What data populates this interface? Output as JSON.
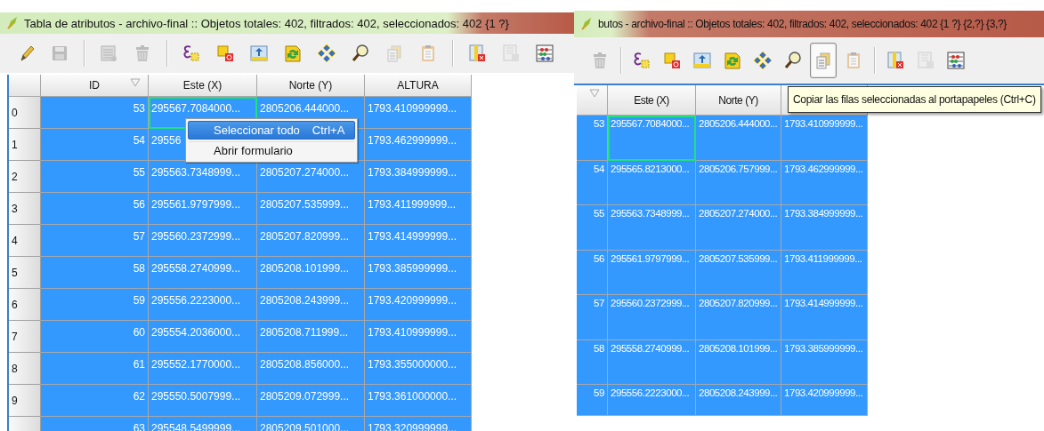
{
  "panels": [
    {
      "title": "Tabla de atributos - archivo-final :: Objetos totales: 402, filtrados: 402, seleccionados: 402 {1 ?}",
      "toolbar": [
        {
          "kind": "edit",
          "disabled": false,
          "hovered": false
        },
        {
          "kind": "save",
          "disabled": true,
          "hovered": false
        },
        {
          "kind": "separator"
        },
        {
          "kind": "delete-rows",
          "disabled": true,
          "hovered": false
        },
        {
          "kind": "trash",
          "disabled": true,
          "hovered": false
        },
        {
          "kind": "separator"
        },
        {
          "kind": "expression",
          "disabled": false,
          "hovered": false
        },
        {
          "kind": "deselect",
          "disabled": false,
          "hovered": false
        },
        {
          "kind": "move-top",
          "disabled": false,
          "hovered": false
        },
        {
          "kind": "invert",
          "disabled": false,
          "hovered": false
        },
        {
          "kind": "pan",
          "disabled": false,
          "hovered": false
        },
        {
          "kind": "zoom",
          "disabled": false,
          "hovered": false
        },
        {
          "kind": "copy",
          "disabled": true,
          "hovered": false
        },
        {
          "kind": "paste",
          "disabled": true,
          "hovered": false
        },
        {
          "kind": "separator"
        },
        {
          "kind": "delete-column",
          "disabled": false,
          "hovered": false
        },
        {
          "kind": "new-column",
          "disabled": true,
          "hovered": false
        },
        {
          "kind": "calculator",
          "disabled": false,
          "hovered": false
        }
      ],
      "table": {
        "columns": [
          {
            "label": "ID",
            "sorted": true
          },
          {
            "label": "Este (X)",
            "sorted": false
          },
          {
            "label": "Norte (Y)",
            "sorted": false
          },
          {
            "label": "ALTURA",
            "sorted": false
          }
        ],
        "rows": [
          {
            "header": "0",
            "selected": true,
            "cells": [
              "53",
              "295567.7084000...",
              "2805206.444000...",
              "1793.410999999..."
            ],
            "current": [
              false,
              true,
              false,
              false
            ]
          },
          {
            "header": "1",
            "selected": true,
            "cells": [
              "54",
              "29556",
              "",
              "1793.462999999..."
            ],
            "current": [
              false,
              false,
              false,
              false
            ]
          },
          {
            "header": "2",
            "selected": true,
            "cells": [
              "55",
              "295563.7348999...",
              "2805207.274000...",
              "1793.384999999..."
            ],
            "current": [
              false,
              false,
              false,
              false
            ]
          },
          {
            "header": "3",
            "selected": true,
            "cells": [
              "56",
              "295561.9797999...",
              "2805207.535999...",
              "1793.411999999..."
            ],
            "current": [
              false,
              false,
              false,
              false
            ]
          },
          {
            "header": "4",
            "selected": true,
            "cells": [
              "57",
              "295560.2372999...",
              "2805207.820999...",
              "1793.414999999..."
            ],
            "current": [
              false,
              false,
              false,
              false
            ]
          },
          {
            "header": "5",
            "selected": true,
            "cells": [
              "58",
              "295558.2740999...",
              "2805208.101999...",
              "1793.385999999..."
            ],
            "current": [
              false,
              false,
              false,
              false
            ]
          },
          {
            "header": "6",
            "selected": true,
            "cells": [
              "59",
              "295556.2223000...",
              "2805208.243999...",
              "1793.420999999..."
            ],
            "current": [
              false,
              false,
              false,
              false
            ]
          },
          {
            "header": "7",
            "selected": true,
            "cells": [
              "60",
              "295554.2036000...",
              "2805208.711999...",
              "1793.410999999..."
            ],
            "current": [
              false,
              false,
              false,
              false
            ]
          },
          {
            "header": "8",
            "selected": true,
            "cells": [
              "61",
              "295552.1770000...",
              "2805208.856000...",
              "1793.355000000..."
            ],
            "current": [
              false,
              false,
              false,
              false
            ]
          },
          {
            "header": "9",
            "selected": true,
            "cells": [
              "62",
              "295550.5007999...",
              "2805209.072999...",
              "1793.361000000..."
            ],
            "current": [
              false,
              false,
              false,
              false
            ]
          },
          {
            "selected": true,
            "cells": [
              "63",
              "295548.5499999...",
              "2805209.501000...",
              "1793.320999999..."
            ],
            "current": [
              false,
              false,
              false,
              false
            ]
          }
        ]
      },
      "context_menu": [
        {
          "label": "Seleccionar todo",
          "shortcut": "Ctrl+A",
          "selected": true
        },
        {
          "label": "Abrir formulario",
          "selected": false
        }
      ]
    },
    {
      "title": "butos - archivo-final :: Objetos totales: 402, filtrados: 402, seleccionados: 402 {1 ?} {2,?} {3,?}",
      "toolbar": [
        {
          "kind": "trash",
          "disabled": true,
          "hovered": false
        },
        {
          "kind": "separator"
        },
        {
          "kind": "expression",
          "disabled": false,
          "hovered": false
        },
        {
          "kind": "deselect",
          "disabled": false,
          "hovered": false
        },
        {
          "kind": "move-top",
          "disabled": false,
          "hovered": false
        },
        {
          "kind": "invert",
          "disabled": false,
          "hovered": false
        },
        {
          "kind": "pan",
          "disabled": false,
          "hovered": false
        },
        {
          "kind": "zoom",
          "disabled": false,
          "hovered": false
        },
        {
          "kind": "copy",
          "disabled": false,
          "hovered": true
        },
        {
          "kind": "paste",
          "disabled": true,
          "hovered": false
        },
        {
          "kind": "separator"
        },
        {
          "kind": "delete-column",
          "disabled": false,
          "hovered": false
        },
        {
          "kind": "new-column",
          "disabled": true,
          "hovered": false
        },
        {
          "kind": "calculator",
          "disabled": false,
          "hovered": false
        }
      ],
      "table": {
        "columns": [
          {
            "sorted": true
          },
          {
            "label": "Este (X)",
            "sorted": false
          },
          {
            "label": "Norte (Y)",
            "sorted": false
          },
          {}
        ],
        "rows": [
          {
            "selected": true,
            "cells": [
              "53",
              "295567.7084000...",
              "2805206.444000...",
              "1793.410999999..."
            ],
            "current": [
              false,
              true,
              false,
              false
            ]
          },
          {
            "selected": true,
            "cells": [
              "54",
              "295565.8213000...",
              "2805206.757999...",
              "1793.462999999..."
            ],
            "current": [
              false,
              false,
              false,
              false
            ]
          },
          {
            "selected": true,
            "cells": [
              "55",
              "295563.7348999...",
              "2805207.274000...",
              "1793.384999999..."
            ],
            "current": [
              false,
              false,
              false,
              false
            ]
          },
          {
            "selected": true,
            "cells": [
              "56",
              "295561.9797999...",
              "2805207.535999...",
              "1793.411999999..."
            ],
            "current": [
              false,
              false,
              false,
              false
            ]
          },
          {
            "selected": true,
            "cells": [
              "57",
              "295560.2372999...",
              "2805207.820999...",
              "1793.414999999..."
            ],
            "current": [
              false,
              false,
              false,
              false
            ]
          },
          {
            "selected": true,
            "cells": [
              "58",
              "295558.2740999...",
              "2805208.101999...",
              "1793.385999999..."
            ],
            "current": [
              false,
              false,
              false,
              false
            ]
          },
          {
            "selected": true,
            "cells": [
              "59",
              "295556.2223000...",
              "2805208.243999...",
              "1793.420999999..."
            ],
            "current": [
              false,
              false,
              false,
              false
            ]
          }
        ]
      },
      "tooltip": "Copiar las filas seleccionadas al portapapeles (Ctrl+C)"
    }
  ]
}
